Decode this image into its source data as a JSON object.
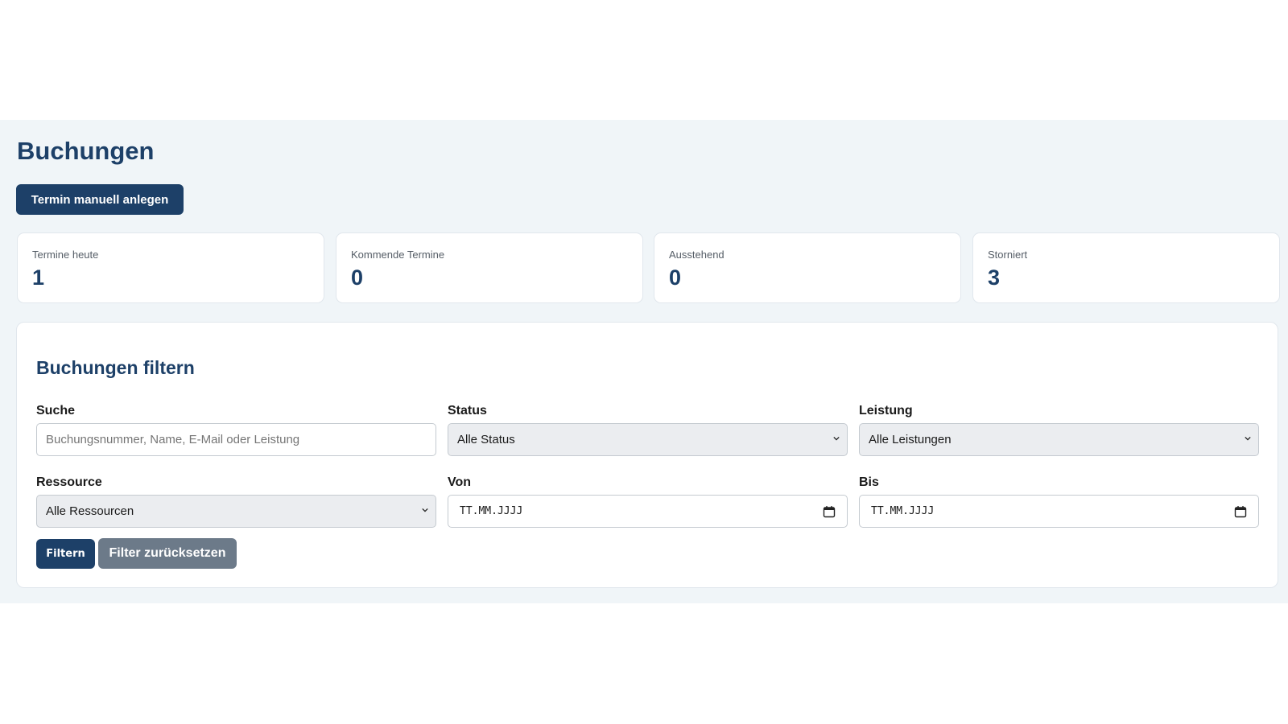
{
  "page": {
    "title": "Buchungen",
    "create_button": "Termin manuell anlegen"
  },
  "stats": [
    {
      "label": "Termine heute",
      "value": "1"
    },
    {
      "label": "Kommende Termine",
      "value": "0"
    },
    {
      "label": "Ausstehend",
      "value": "0"
    },
    {
      "label": "Storniert",
      "value": "3"
    }
  ],
  "filter": {
    "title": "Buchungen filtern",
    "search": {
      "label": "Suche",
      "placeholder": "Buchungsnummer, Name, E-Mail oder Leistung"
    },
    "status": {
      "label": "Status",
      "value": "Alle Status"
    },
    "service": {
      "label": "Leistung",
      "value": "Alle Leistungen"
    },
    "resource": {
      "label": "Ressource",
      "value": "Alle Ressourcen"
    },
    "from": {
      "label": "Von",
      "value": "TT.MM.JJJJ"
    },
    "to": {
      "label": "Bis",
      "value": "TT.MM.JJJJ"
    },
    "submit_button": "Filtern",
    "reset_button": "Filter zurücksetzen"
  },
  "colors": {
    "primary": "#1d4068",
    "secondary_button": "#6c7a89",
    "background": "#f0f5f8"
  },
  "icons": {
    "select_arrow": "chevron-down-icon",
    "date_picker": "calendar-icon"
  }
}
